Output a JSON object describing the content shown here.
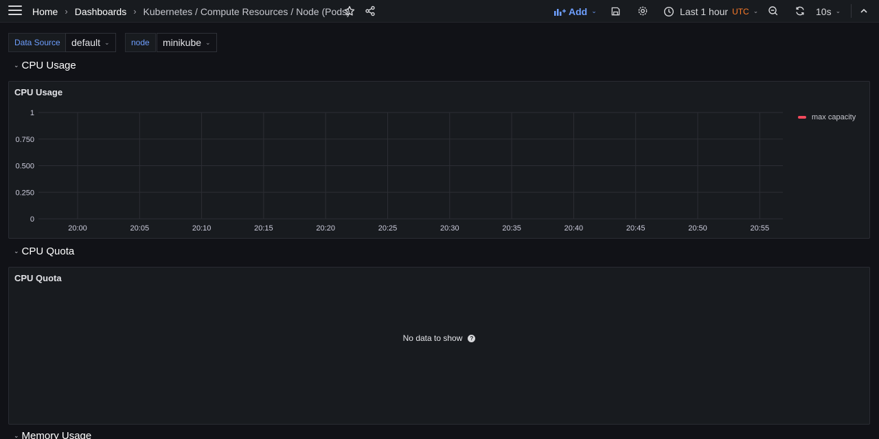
{
  "breadcrumb": {
    "home": "Home",
    "dashboards": "Dashboards",
    "current": "Kubernetes / Compute Resources / Node (Pods)"
  },
  "toolbar": {
    "add_label": "Add",
    "time_range": "Last 1 hour",
    "timezone": "UTC",
    "refresh_interval": "10s"
  },
  "variables": [
    {
      "label": "Data Source",
      "value": "default"
    },
    {
      "label": "node",
      "value": "minikube"
    }
  ],
  "rows": {
    "cpu_usage": "CPU Usage",
    "cpu_quota": "CPU Quota",
    "memory_usage": "Memory Usage"
  },
  "panels": {
    "cpu_usage": {
      "title": "CPU Usage",
      "legend": "max capacity",
      "legend_color": "#f2495c"
    },
    "cpu_quota": {
      "title": "CPU Quota",
      "message": "No data to show"
    }
  },
  "chart_data": {
    "type": "line",
    "title": "CPU Usage",
    "x": [
      "20:00",
      "20:05",
      "20:10",
      "20:15",
      "20:20",
      "20:25",
      "20:30",
      "20:35",
      "20:40",
      "20:45",
      "20:50",
      "20:55"
    ],
    "y_ticks": [
      "0",
      "0.250",
      "0.500",
      "0.750",
      "1"
    ],
    "ylim": [
      0,
      1
    ],
    "series": [
      {
        "name": "max capacity",
        "values": []
      }
    ],
    "grid": true,
    "legend_position": "right"
  },
  "colors": {
    "accent": "#6e9fff",
    "timezone": "#ff7c29",
    "background": "#111217",
    "panel": "#181b1f"
  }
}
